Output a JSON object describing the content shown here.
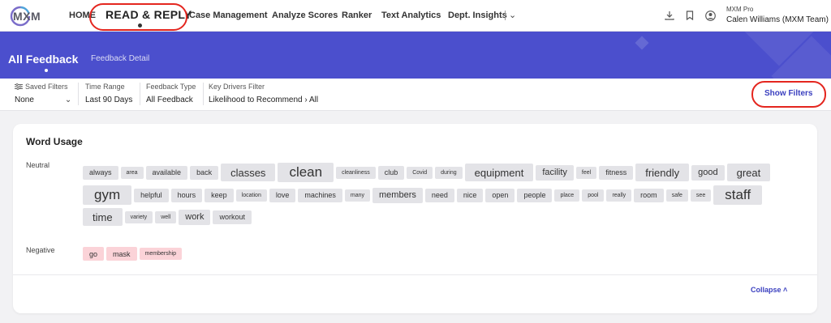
{
  "app": {
    "logo_text": "MXM"
  },
  "nav": {
    "items": [
      {
        "label": "HOME"
      },
      {
        "label": "READ & REPLY"
      },
      {
        "label": "Case Management"
      },
      {
        "label": "Analyze Scores"
      },
      {
        "label": "Ranker"
      },
      {
        "label": "Text Analytics"
      },
      {
        "label": "Dept. Insights"
      }
    ],
    "active_index": 1
  },
  "account": {
    "product": "MXM Pro",
    "user": "Calen Williams (MXM Team)"
  },
  "banner": {
    "title": "All Feedback",
    "subtitle": "Feedback Detail"
  },
  "filters": {
    "saved": {
      "label": "Saved Filters",
      "value": "None"
    },
    "time_range": {
      "label": "Time Range",
      "value": "Last 90 Days"
    },
    "feedback_type": {
      "label": "Feedback Type",
      "value": "All Feedback"
    },
    "key_drivers": {
      "label": "Key Drivers Filter",
      "value": "Likelihood to Recommend › All"
    },
    "show_filters_label": "Show Filters"
  },
  "word_usage": {
    "title": "Word Usage",
    "neutral": {
      "label": "Neutral",
      "words": [
        {
          "text": "always",
          "size": 2
        },
        {
          "text": "area",
          "size": 1
        },
        {
          "text": "available",
          "size": 2
        },
        {
          "text": "back",
          "size": 2
        },
        {
          "text": "classes",
          "size": 4
        },
        {
          "text": "clean",
          "size": 5
        },
        {
          "text": "cleanliness",
          "size": 1
        },
        {
          "text": "club",
          "size": 2
        },
        {
          "text": "Covid",
          "size": 1
        },
        {
          "text": "during",
          "size": 1
        },
        {
          "text": "equipment",
          "size": 4
        },
        {
          "text": "facility",
          "size": 3
        },
        {
          "text": "feel",
          "size": 1
        },
        {
          "text": "fitness",
          "size": 2
        },
        {
          "text": "friendly",
          "size": 4
        },
        {
          "text": "good",
          "size": 3
        },
        {
          "text": "great",
          "size": 4
        },
        {
          "text": "gym",
          "size": 5
        },
        {
          "text": "helpful",
          "size": 2
        },
        {
          "text": "hours",
          "size": 2
        },
        {
          "text": "keep",
          "size": 2
        },
        {
          "text": "location",
          "size": 1
        },
        {
          "text": "love",
          "size": 2
        },
        {
          "text": "machines",
          "size": 2
        },
        {
          "text": "many",
          "size": 1
        },
        {
          "text": "members",
          "size": 3
        },
        {
          "text": "need",
          "size": 2
        },
        {
          "text": "nice",
          "size": 2
        },
        {
          "text": "open",
          "size": 2
        },
        {
          "text": "people",
          "size": 2
        },
        {
          "text": "place",
          "size": 1
        },
        {
          "text": "pool",
          "size": 1
        },
        {
          "text": "really",
          "size": 1
        },
        {
          "text": "room",
          "size": 2
        },
        {
          "text": "safe",
          "size": 1
        },
        {
          "text": "see",
          "size": 1
        },
        {
          "text": "staff",
          "size": 5
        },
        {
          "text": "time",
          "size": 4
        },
        {
          "text": "variety",
          "size": 1
        },
        {
          "text": "well",
          "size": 1
        },
        {
          "text": "work",
          "size": 3
        },
        {
          "text": "workout",
          "size": 2
        }
      ]
    },
    "negative": {
      "label": "Negative",
      "words": [
        {
          "text": "go",
          "size": 2
        },
        {
          "text": "mask",
          "size": 2
        },
        {
          "text": "membership",
          "size": 1
        }
      ]
    },
    "collapse_label": "Collapse ˄"
  },
  "colors": {
    "accent": "#4b4fcd",
    "link": "#3a3fbf",
    "highlight": "#e4261f",
    "negative_tag": "#fbd3d8",
    "neutral_tag": "#e3e3e7"
  }
}
